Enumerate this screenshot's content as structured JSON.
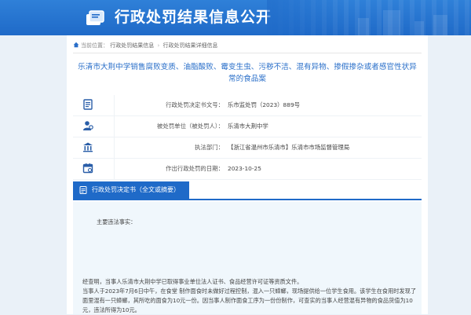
{
  "header": {
    "title": "行政处罚结果信息公开",
    "logo_icon": "books-icon",
    "colors": {
      "primary": "#1f6ac8",
      "light": "#eaf1f8"
    }
  },
  "breadcrumb": {
    "label": "当前位置：",
    "items": [
      "行政处罚结果信息",
      "行政处罚结果详细信息"
    ]
  },
  "case": {
    "title": "乐清市大荆中学销售腐败变质、油脂酸败、霉变生虫、污秽不洁、混有异物、掺假掺杂或者感官性状异常的食品案"
  },
  "info": [
    {
      "icon": "document-icon",
      "label": "行政处罚决定书文号：",
      "value": "乐市监处罚（2023）889号"
    },
    {
      "icon": "user-icon",
      "label": "被处罚单位（被处罚人）：",
      "value": "乐清市大荆中学"
    },
    {
      "icon": "building-icon",
      "label": "执法部门：",
      "value": "【浙江省温州市乐清市】乐清市市场监督管理局"
    },
    {
      "icon": "calendar-icon",
      "label": "作出行政处罚的日期：",
      "value": "2023-10-25"
    }
  ],
  "decision": {
    "tab_label": "行政处罚决定书（全文或摘要）",
    "tab_icon": "document-list-icon",
    "fact_label": "主要违法事实：",
    "paragraphs": [
      "经查明，当事人乐清市大荆中学已取得事业单位法人证书、食品经营许可证等资质文件。",
      "当事人于2023年7月6日中午，在食堂 制作面食时未做好过程控制，混入一只蟑螂，现场提供给一位学生食用。该学生在食用时发现了面里混有一只蟑螂，其所吃的面食为10元一份。因当事人制作面食工序为一份份制作，可查实的当事人经营混有异物的食品货值为10元，违法所得为10元。"
    ]
  }
}
